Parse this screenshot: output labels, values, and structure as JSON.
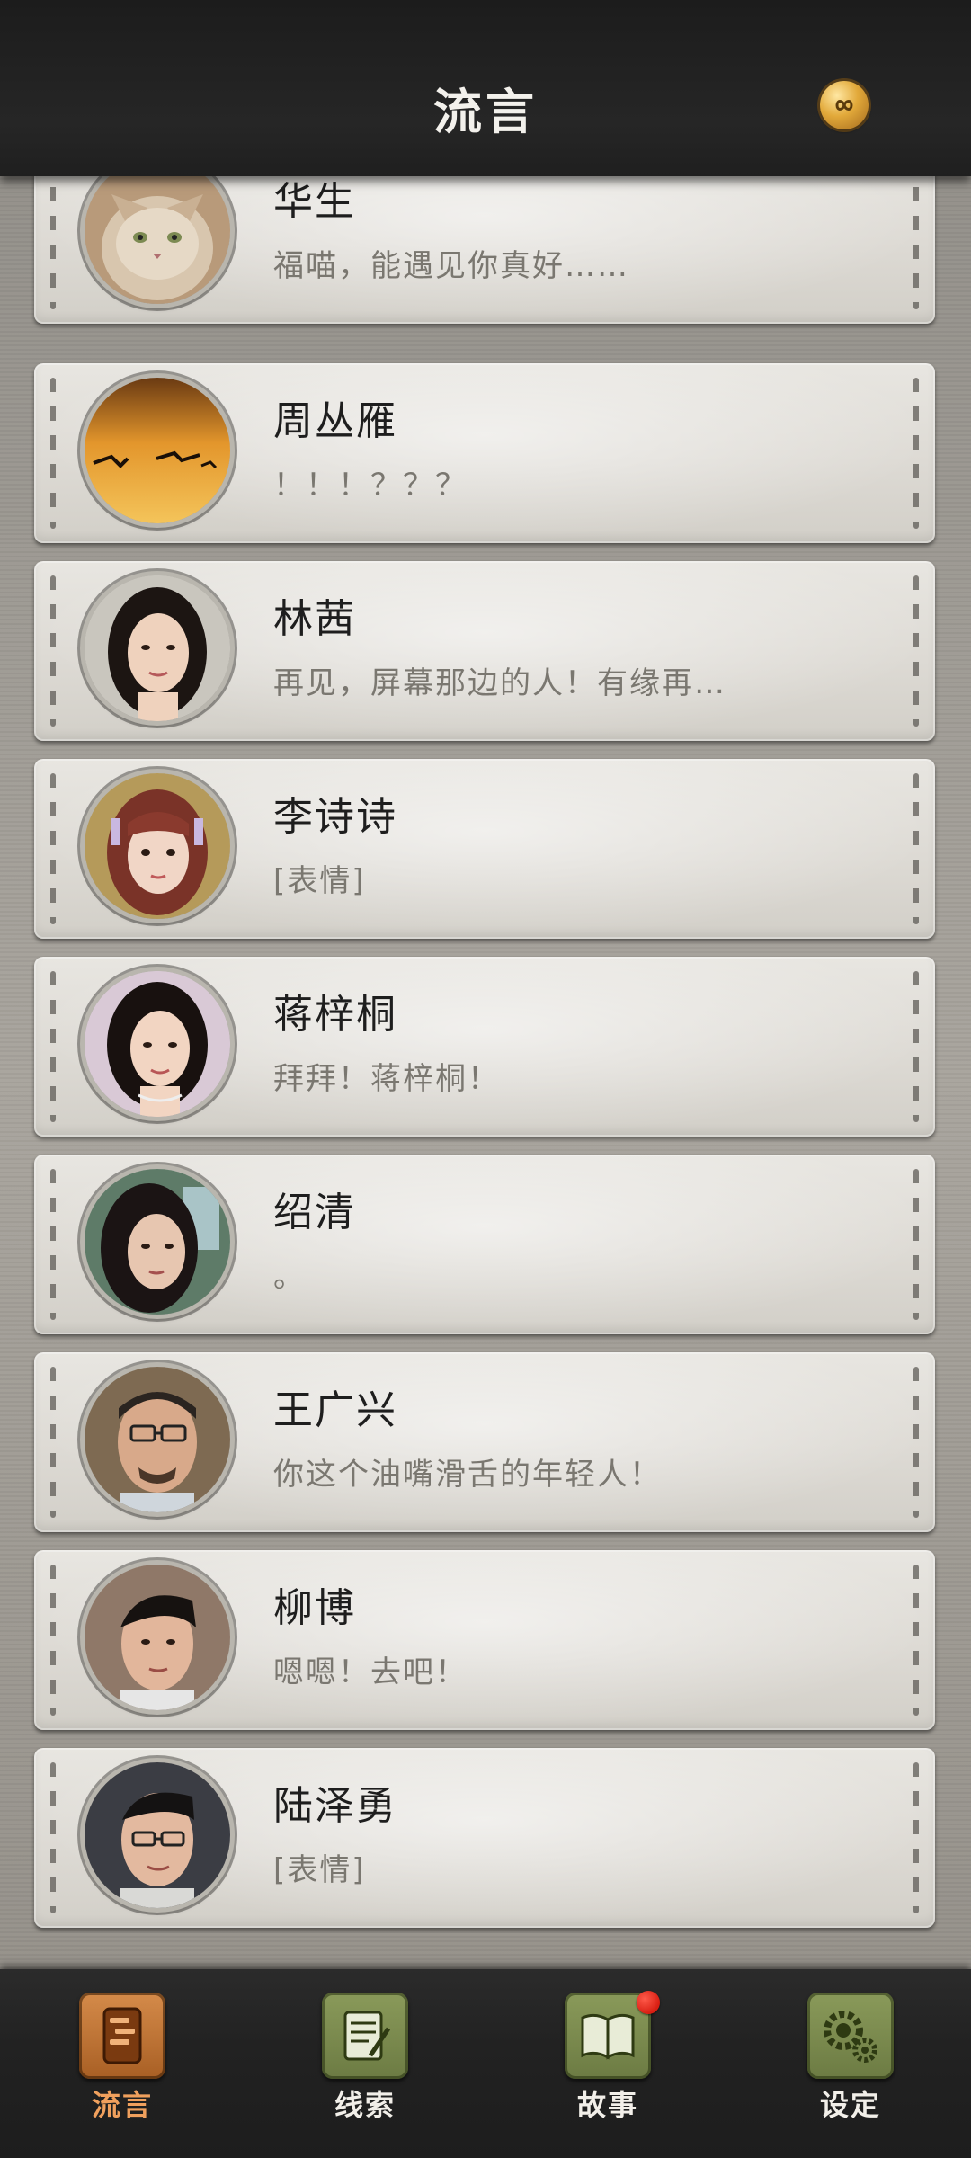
{
  "header": {
    "title": "流言",
    "coin_icon": "infinity-coin-icon"
  },
  "chats": [
    {
      "name": "华生",
      "preview": "福喵，能遇见你真好……",
      "avatar": "cat-avatar"
    },
    {
      "name": "周丛雁",
      "preview": "！！！？？？",
      "avatar": "sunset-geese-avatar"
    },
    {
      "name": "林茜",
      "preview": "再见，屏幕那边的人！有缘再…",
      "avatar": "woman-avatar"
    },
    {
      "name": "李诗诗",
      "preview": "[表情]",
      "avatar": "woman-avatar"
    },
    {
      "name": "蒋梓桐",
      "preview": "拜拜！蒋梓桐！",
      "avatar": "woman-avatar"
    },
    {
      "name": "绍清",
      "preview": "。",
      "avatar": "woman-avatar"
    },
    {
      "name": "王广兴",
      "preview": "你这个油嘴滑舌的年轻人！",
      "avatar": "man-glasses-avatar"
    },
    {
      "name": "柳博",
      "preview": "嗯嗯！去吧！",
      "avatar": "man-avatar"
    },
    {
      "name": "陆泽勇",
      "preview": "[表情]",
      "avatar": "man-glasses-avatar"
    }
  ],
  "nav": [
    {
      "label": "流言",
      "icon": "phone-chat-icon",
      "active": true
    },
    {
      "label": "线索",
      "icon": "notepad-icon",
      "active": false
    },
    {
      "label": "故事",
      "icon": "book-icon",
      "active": false,
      "badge": true
    },
    {
      "label": "设定",
      "icon": "gears-icon",
      "active": false
    }
  ],
  "colors": {
    "header_bg": "#1f1f1f",
    "card_bg": "#dddad4",
    "active_nav": "#f0a05d",
    "badge": "#d81e12"
  }
}
